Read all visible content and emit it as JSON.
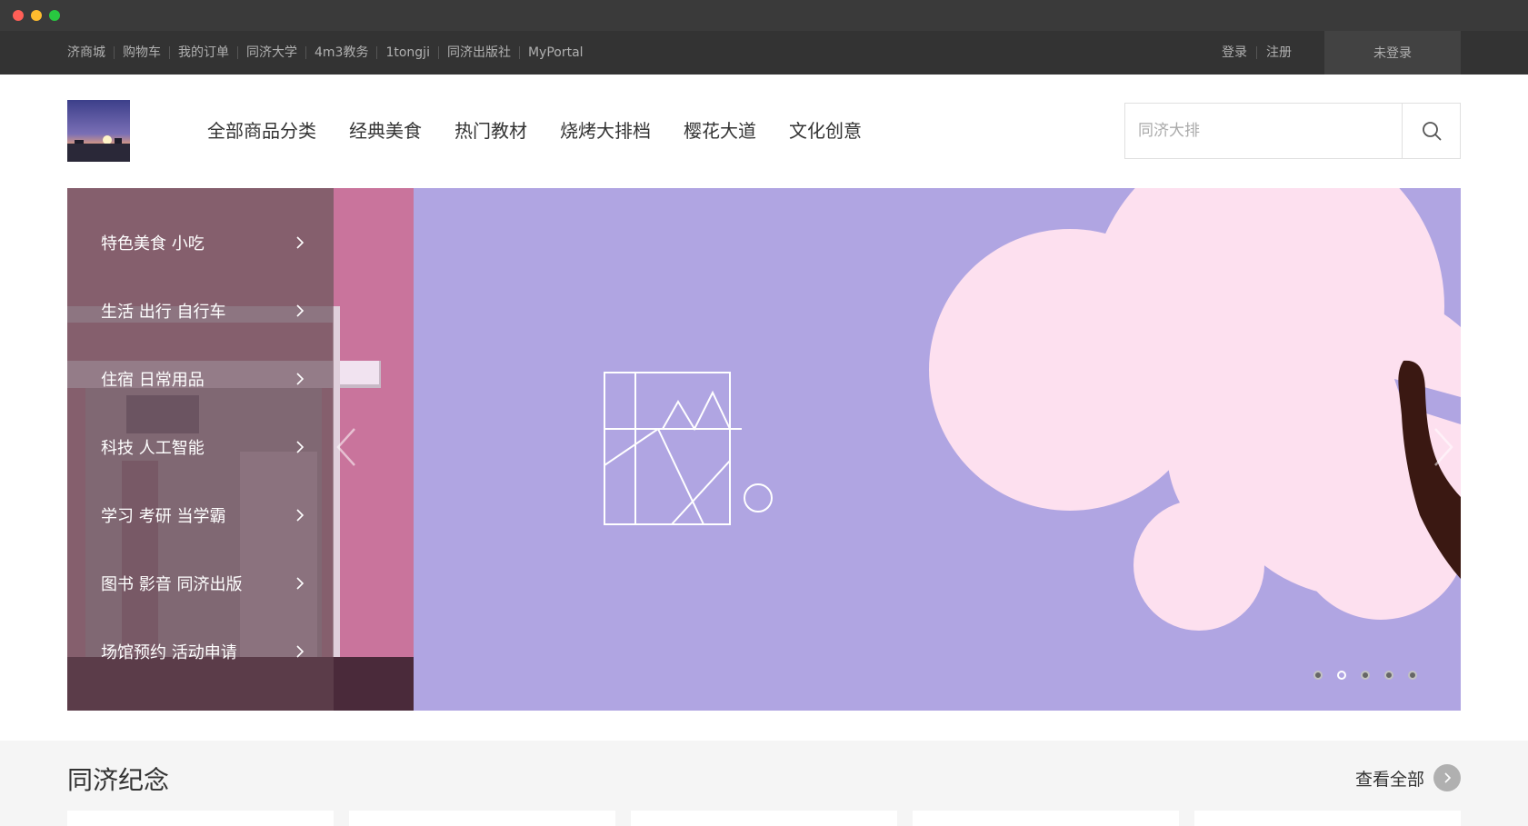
{
  "topbar": {
    "links": [
      "济商城",
      "购物车",
      "我的订单",
      "同济大学",
      "4m3教务",
      "1tongji",
      "同济出版社",
      "MyPortal"
    ],
    "login": "登录",
    "register": "注册",
    "user_status": "未登录"
  },
  "header": {
    "nav": [
      "全部商品分类",
      "经典美食",
      "热门教材",
      "烧烤大排档",
      "樱花大道",
      "文化创意"
    ],
    "search": {
      "placeholder": "同济大排",
      "value": ""
    },
    "search_icon": "search-icon"
  },
  "banner": {
    "categories": [
      "特色美食 小吃",
      "生活 出行 自行车",
      "住宿 日常用品",
      "科技 人工智能",
      "学习 考研 当学霸",
      "图书 影音 同济出版",
      "场馆预约 活动申请"
    ],
    "slide_count": 5,
    "active_slide": 2,
    "colors": {
      "lilac": "#b0a5e2",
      "pink": "#fde0ef",
      "rose": "#c9749c",
      "trunk": "#3a1812"
    }
  },
  "section": {
    "title": "同济纪念",
    "view_all": "查看全部"
  }
}
